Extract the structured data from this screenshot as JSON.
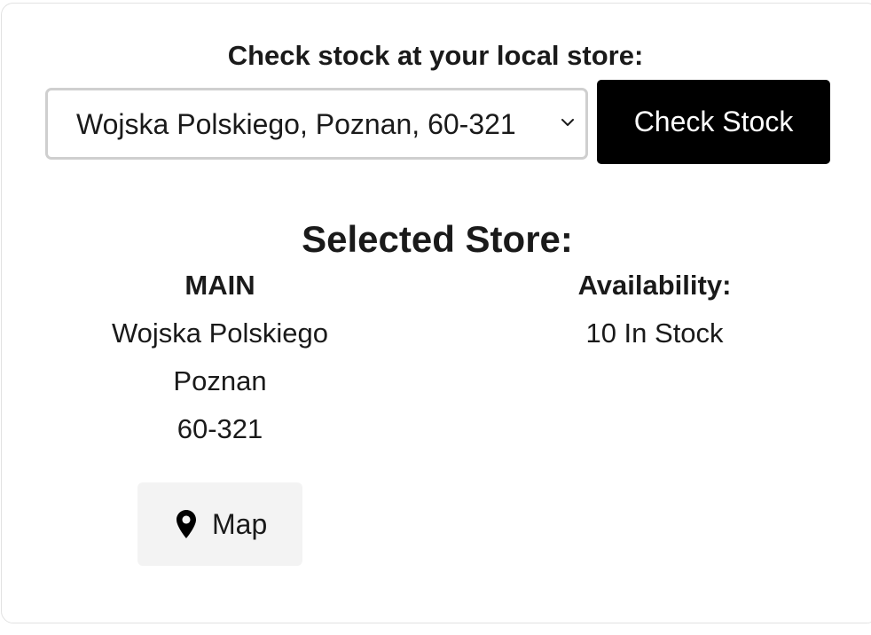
{
  "stock_check": {
    "prompt": "Check stock at your local store:",
    "store_select": {
      "selected": "Wojska Polskiego, Poznan, 60-321"
    },
    "check_button": "Check Stock"
  },
  "selected_store": {
    "title": "Selected Store:",
    "store_name": "MAIN",
    "street": "Wojska Polskiego",
    "city": "Poznan",
    "postal_code": "60-321",
    "availability_label": "Availability:",
    "availability_value": "10 In Stock",
    "map_button": "Map"
  },
  "icons": {
    "dropdown": "chevron-down-icon",
    "map": "map-pin-icon"
  },
  "colors": {
    "button_bg": "#000000",
    "button_text": "#ffffff",
    "map_button_bg": "#f3f3f3",
    "select_border": "#cfcfcf",
    "card_border": "#e2e2e2"
  }
}
